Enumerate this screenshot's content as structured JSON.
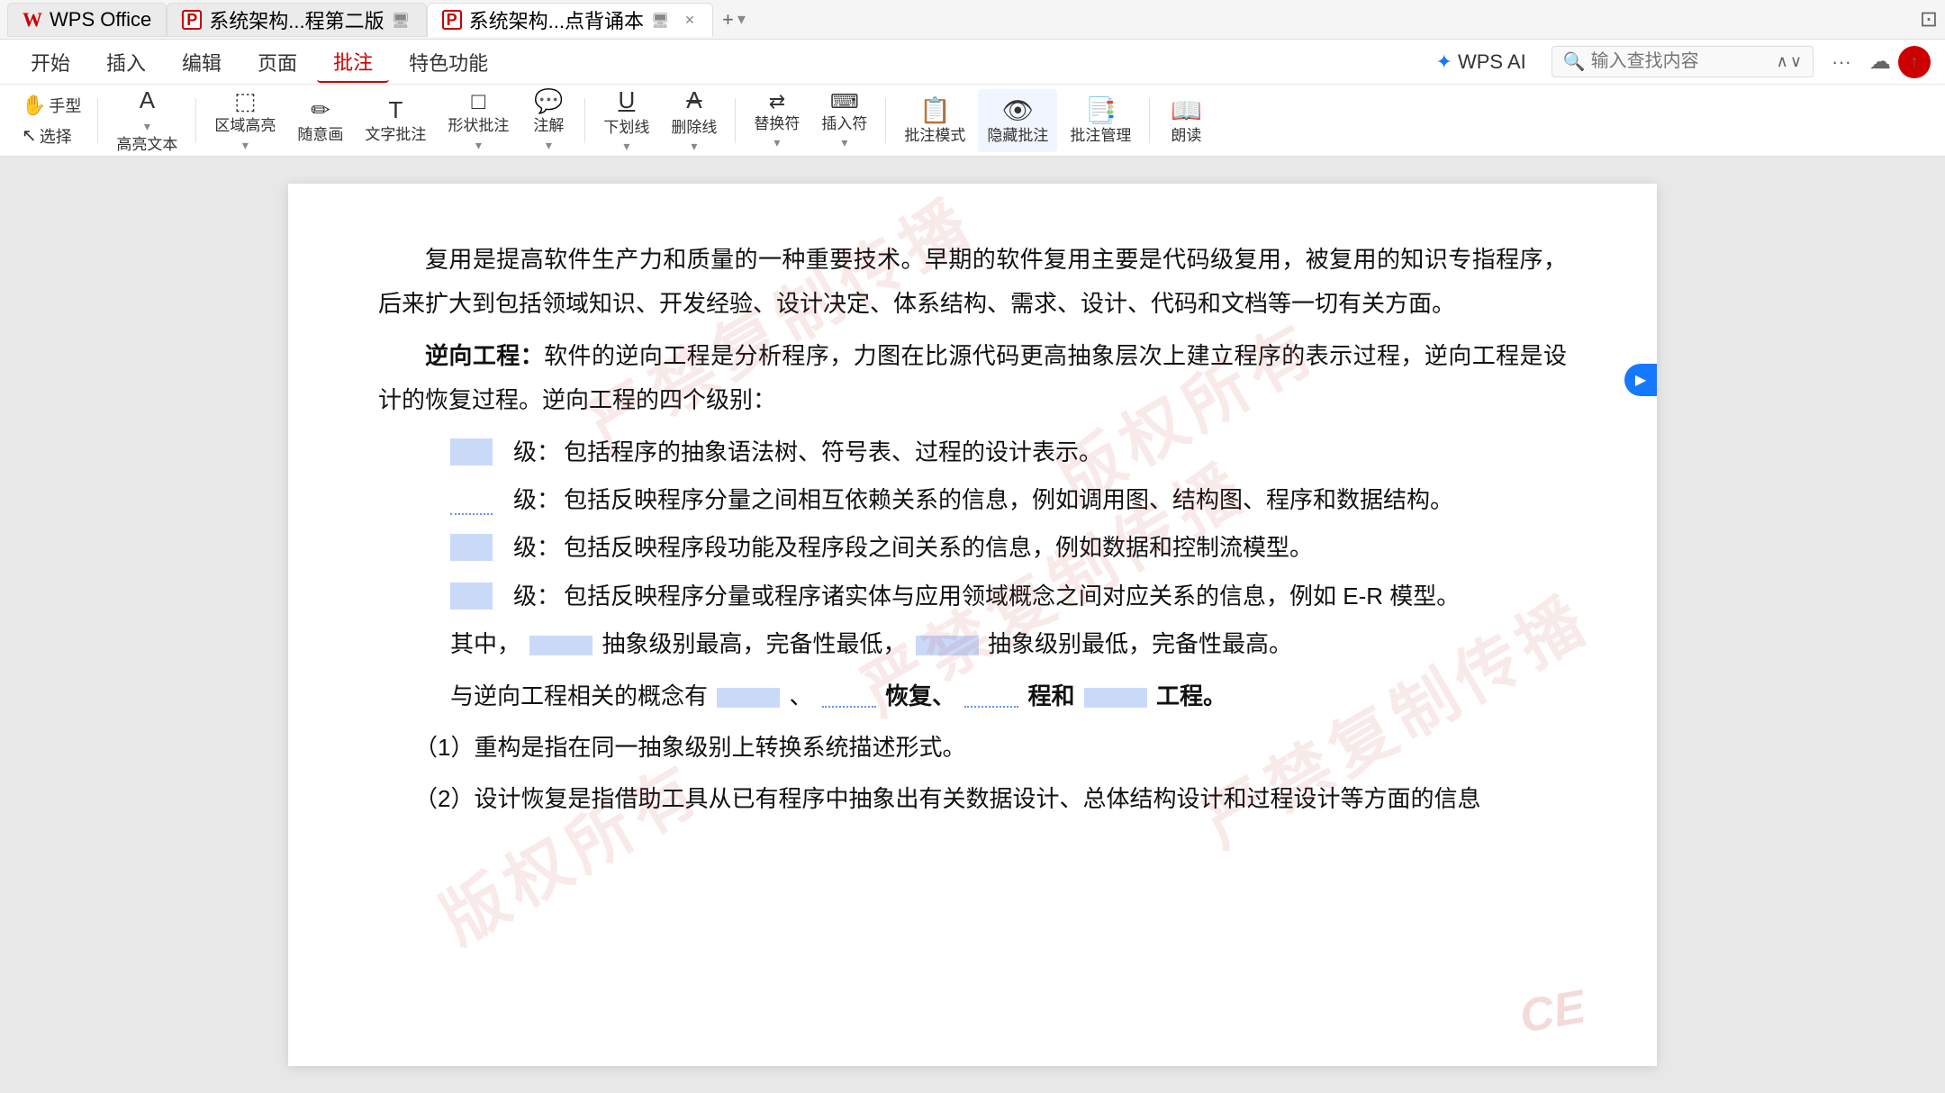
{
  "titlebar": {
    "tabs": [
      {
        "id": "tab1",
        "icon": "wps-w",
        "label": "WPS Office",
        "closable": false,
        "active": false
      },
      {
        "id": "tab2",
        "icon": "pdf",
        "label": "系统架构...程第二版",
        "monitor": true,
        "closable": false,
        "active": false
      },
      {
        "id": "tab3",
        "icon": "pdf",
        "label": "系统架构...点背诵本",
        "monitor": true,
        "closable": true,
        "active": true
      }
    ],
    "add_tab_label": "+",
    "dropdown_label": "▾"
  },
  "menubar": {
    "items": [
      "开始",
      "插入",
      "编辑",
      "页面",
      "批注",
      "特色功能"
    ],
    "active_item": "批注",
    "wps_ai": "WPS AI",
    "search_placeholder": "输入查找内容",
    "more_icon": "···"
  },
  "toolbar": {
    "hand_label": "手型",
    "select_label": "选择",
    "highlight_label": "高亮文本",
    "area_highlight_label": "区域高亮",
    "freehand_label": "随意画",
    "text_comment_label": "文字批注",
    "shape_comment_label": "形状批注",
    "annotation_label": "注解",
    "underline_label": "下划线",
    "delete_label": "删除线",
    "replace_label": "替换符",
    "insert_symbol_label": "插入符",
    "comment_mode_label": "批注模式",
    "hide_comment_label": "隐藏批注",
    "comment_manage_label": "批注管理",
    "read_label": "朗读"
  },
  "document": {
    "paragraph1": "复用是提高软件生产力和质量的一种重要技术。早期的软件复用主要是代码级复用，被复用的知识专指程序，后来扩大到包括领域知识、开发经验、设计决定、体系结构、需求、设计、代码和文档等一切有关方面。",
    "reverse_eng_title": "逆向工程：",
    "reverse_eng_body": "软件的逆向工程是分析程序，力图在比源代码更高抽象层次上建立程序的表示过程，逆向工程是设计的恢复过程。逆向工程的四个级别：",
    "level1_label": "级：",
    "level1_text": "包括程序的抽象语法树、符号表、过程的设计表示。",
    "level2_label": "级：",
    "level2_text": "包括反映程序分量之间相互依赖关系的信息，例如调用图、结构图、程序和数据结构。",
    "level3_label": "级：",
    "level3_text": "包括反映程序段功能及程序段之间关系的信息，例如数据和控制流模型。",
    "level4_label": "级：",
    "level4_text": "包括反映程序分量或程序诸实体与应用领域概念之间对应关系的信息，例如 E-R 模型。",
    "summary_text1": "其中，",
    "summary_blank1": "",
    "summary_text2": "抽象级别最高，完备性最低，",
    "summary_blank2": "",
    "summary_text3": "抽象级别最低，完备性最高。",
    "related_text": "与逆向工程相关的概念有",
    "related_blank1": "",
    "related_sep1": "、",
    "related_blank2": "",
    "related_text2": "恢复、",
    "related_blank3": "",
    "related_text3": "程和",
    "related_blank4": "",
    "related_text4": "工程。",
    "item1": "（1）重构是指在同一抽象级别上转换系统描述形式。",
    "item2": "（2）设计恢复是指借助工具从已有程序中抽象出有关数据设计、总体结构设计和过程设计等方面的信息",
    "watermark1": "严禁复制传播",
    "watermark2": "版权所有",
    "ce_text": "CE"
  }
}
